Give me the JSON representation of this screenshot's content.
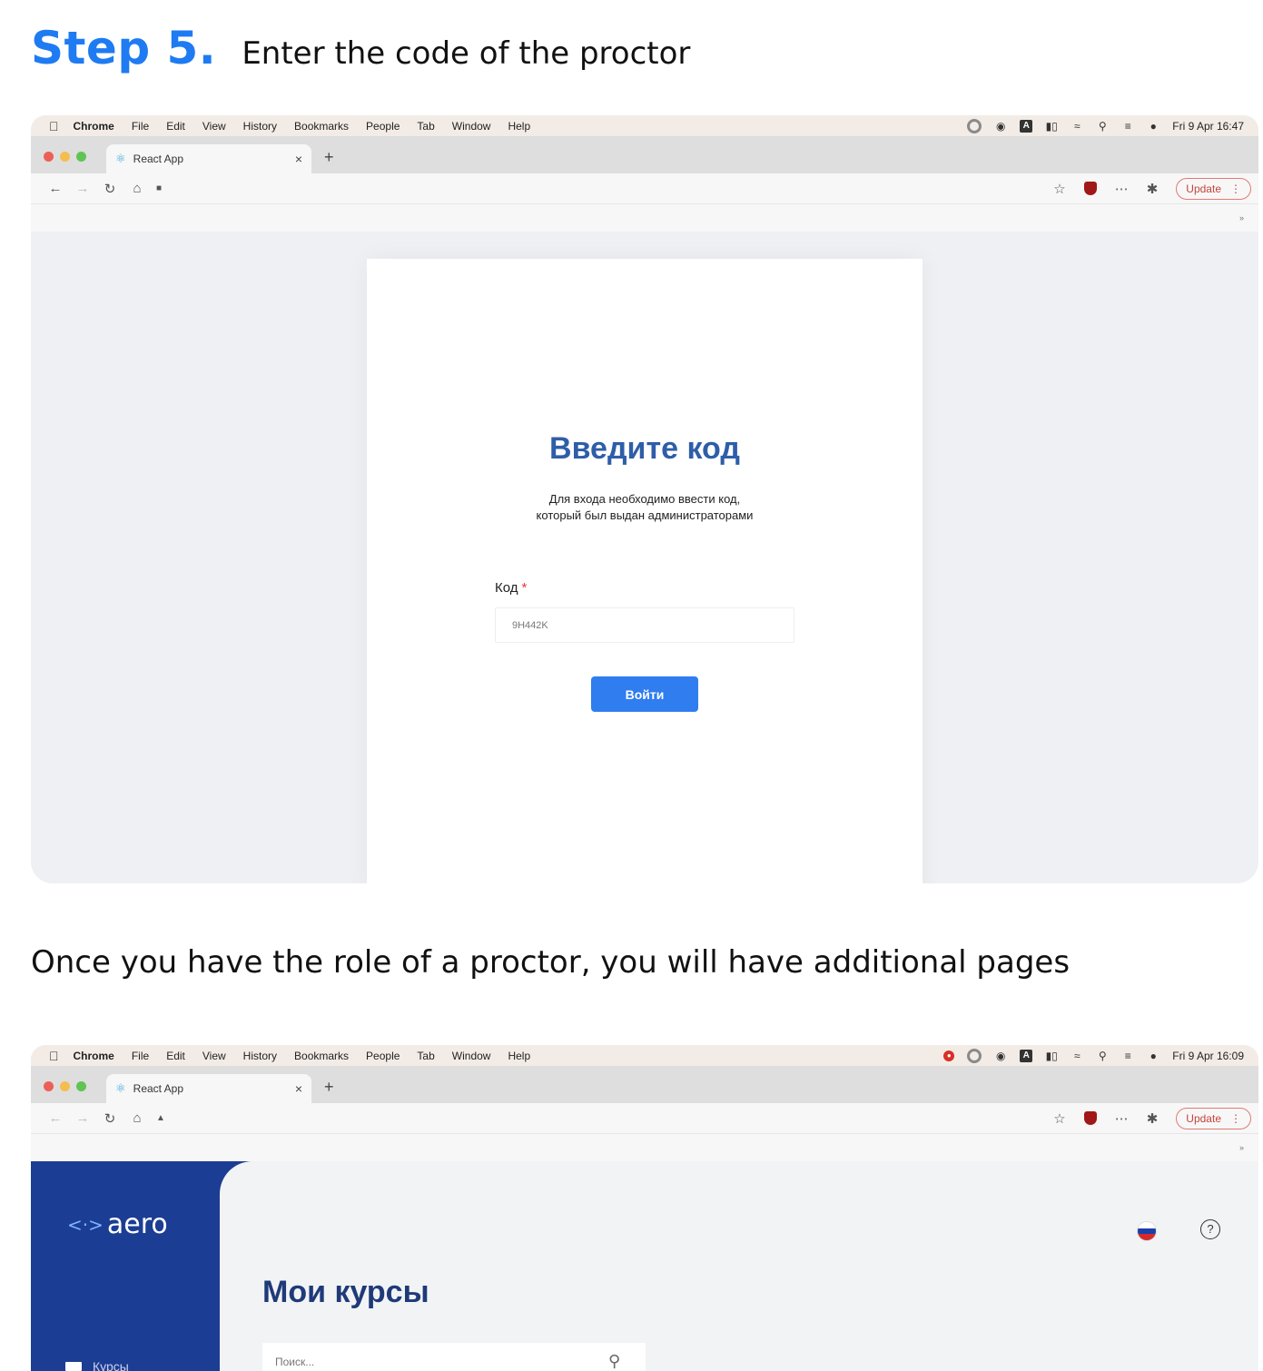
{
  "heading": {
    "step": "Step 5.",
    "text": "Enter the code of the proctor"
  },
  "caption": "Once you have the role of a proctor, you will have additional pages",
  "menubar": {
    "items": [
      "Chrome",
      "File",
      "Edit",
      "View",
      "History",
      "Bookmarks",
      "People",
      "Tab",
      "Window",
      "Help"
    ],
    "clock1": "Fri 9 Apr  16:47",
    "clock2": "Fri 9 Apr  16:09"
  },
  "tab": {
    "title": "React App",
    "close": "×",
    "new": "+"
  },
  "toolbar": {
    "update": "Update",
    "update_menu": "⋮",
    "bookmarks_more": "»"
  },
  "login": {
    "title": "Введите код",
    "subtitle_line1": "Для входа необходимо ввести код,",
    "subtitle_line2": "который был выдан администраторами",
    "code_label": "Код",
    "required_mark": "*",
    "code_value": "9H442K",
    "submit": "Войти"
  },
  "dashboard": {
    "logo_mark": "<·>",
    "logo_text": "aero",
    "help": "?",
    "title": "Мои курсы",
    "search_placeholder": "Поиск...",
    "sidebar_item": "Курсы"
  }
}
